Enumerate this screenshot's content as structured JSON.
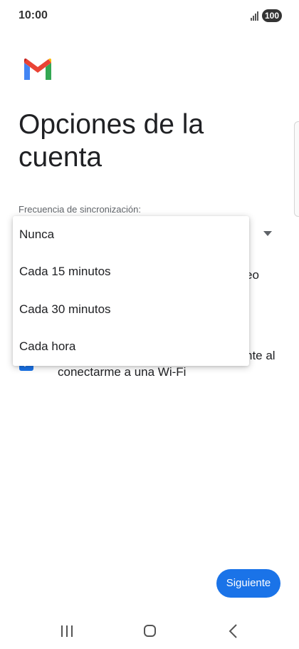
{
  "status_bar": {
    "time": "10:00",
    "battery": "100",
    "signal_icon": "signal-icon"
  },
  "app": {
    "logo": "gmail-logo",
    "title": "Opciones de la cuenta"
  },
  "sync": {
    "label": "Frecuencia de sincronización:",
    "selected_hidden_arrow": "dropdown-arrow-icon",
    "menu_options": [
      "Nunca",
      "Cada 15 minutos",
      "Cada 30 minutos",
      "Cada hora"
    ]
  },
  "background": {
    "option1_visible_tail": "eo",
    "option2_visible_tail": "nte al",
    "option2_line2": "conectarme a una Wi-Fi",
    "checkbox_checked": true
  },
  "actions": {
    "next_label": "Siguiente"
  },
  "nav": {
    "recents_icon": "recents-icon",
    "home_icon": "home-icon",
    "back_icon": "back-icon"
  },
  "colors": {
    "accent": "#1a73e8",
    "text": "#202124",
    "secondary_text": "#5f6368"
  }
}
